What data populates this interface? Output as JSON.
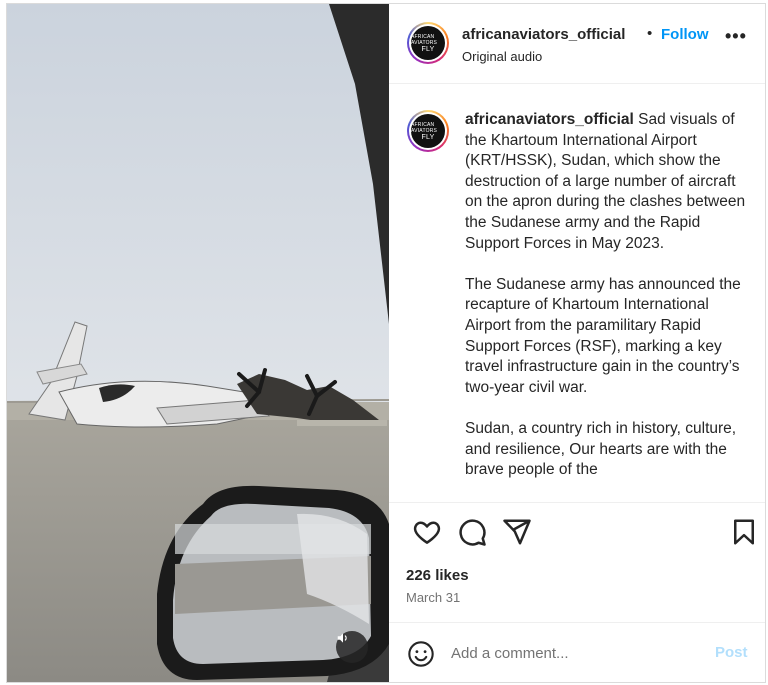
{
  "post": {
    "username": "africanaviators_official",
    "separator": "•",
    "follow_label": "Follow",
    "audio_label": "Original audio",
    "more_label": "•••",
    "avatar_text_top": "AFRICAN AVIATORS",
    "avatar_text_bottom": "FLY"
  },
  "caption": {
    "username": "africanaviators_official",
    "paragraph_1": "Sad visuals of the Khartoum International Airport (KRT/HSSK), Sudan, which show the destruction of a large number of aircraft on the apron during the clashes between the Sudanese army and the Rapid Support Forces in May 2023.",
    "paragraph_2": "The Sudanese army has announced the recapture of Khartoum International Airport from the paramilitary Rapid Support Forces (RSF), marking a key travel infrastructure gain in the country’s two-year civil war.",
    "paragraph_3": "Sudan, a country rich in history, culture, and resilience, Our hearts are with the brave people of the"
  },
  "stats": {
    "likes": "226 likes",
    "date": "March 31"
  },
  "comment_box": {
    "placeholder": "Add a comment...",
    "post_label": "Post"
  },
  "icons": {
    "like": "heart-icon",
    "comment": "comment-icon",
    "share": "share-icon",
    "save": "bookmark-icon",
    "emoji": "emoji-icon",
    "audio": "volume-icon"
  },
  "colors": {
    "accent": "#0095f6",
    "post_disabled": "#b2dffc"
  }
}
